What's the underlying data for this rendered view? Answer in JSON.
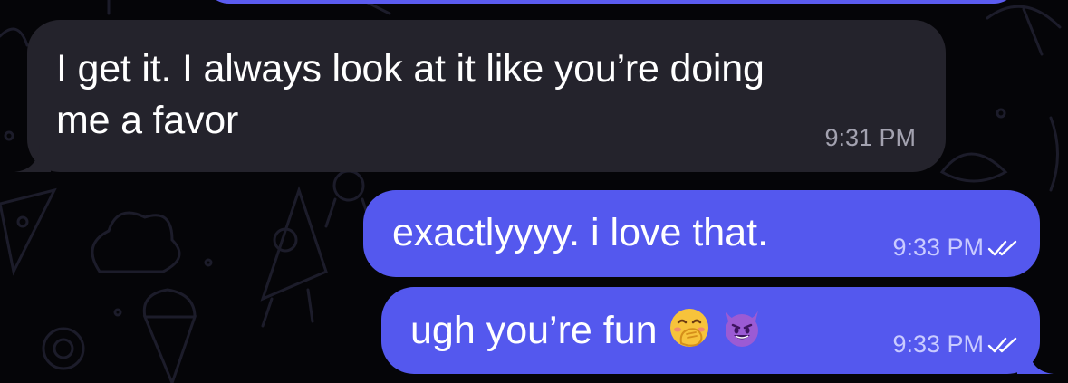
{
  "messages": [
    {
      "direction": "incoming",
      "text": "I get it. I always look at it like you’re doing\nme a favor",
      "time": "9:31 PM"
    },
    {
      "direction": "outgoing",
      "text": "exactlyyyy. i love that.",
      "time": "9:33 PM",
      "status_icon": "double-check-icon"
    },
    {
      "direction": "outgoing",
      "text": "ugh you’re fun",
      "emojis": [
        "hand-over-mouth-emoji",
        "smiling-devil-emoji"
      ],
      "time": "9:33 PM",
      "status_icon": "double-check-icon"
    }
  ],
  "colors": {
    "background": "#050508",
    "incoming_bubble": "#24232c",
    "outgoing_bubble": "#5458ee",
    "incoming_time": "#a3a2b0",
    "outgoing_time": "#c9cbff",
    "pattern": "#1b1b28"
  }
}
